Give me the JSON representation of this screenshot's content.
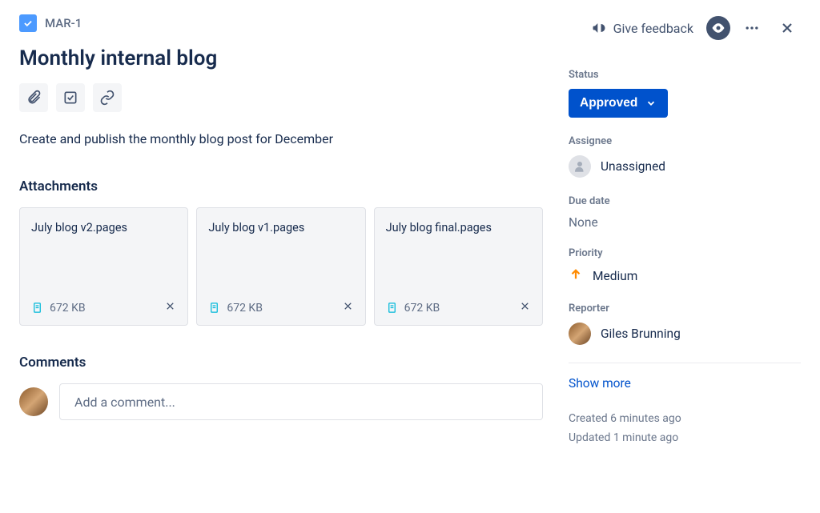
{
  "issue": {
    "key": "MAR-1",
    "title": "Monthly internal blog",
    "description": "Create and publish the monthly blog post for December"
  },
  "header": {
    "feedback_label": "Give feedback"
  },
  "sections": {
    "attachments_label": "Attachments",
    "comments_label": "Comments"
  },
  "attachments": [
    {
      "name": "July blog v2.pages",
      "size": "672 KB"
    },
    {
      "name": "July blog v1.pages",
      "size": "672 KB"
    },
    {
      "name": "July blog final.pages",
      "size": "672 KB"
    }
  ],
  "comment_box": {
    "placeholder": "Add a comment..."
  },
  "side": {
    "status_label": "Status",
    "status_value": "Approved",
    "assignee_label": "Assignee",
    "assignee_value": "Unassigned",
    "duedate_label": "Due date",
    "duedate_value": "None",
    "priority_label": "Priority",
    "priority_value": "Medium",
    "reporter_label": "Reporter",
    "reporter_value": "Giles Brunning",
    "show_more": "Show more",
    "created": "Created 6 minutes ago",
    "updated": "Updated 1 minute ago"
  }
}
